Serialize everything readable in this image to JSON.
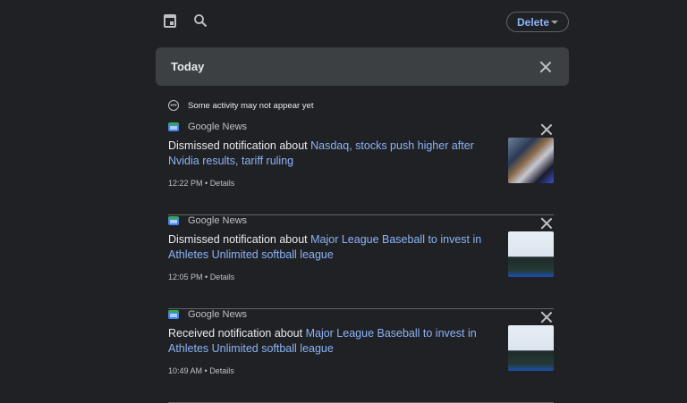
{
  "toolbar": {
    "delete_label": "Delete"
  },
  "section": {
    "title": "Today"
  },
  "notice": "Some activity may not appear yet",
  "items": [
    {
      "source": "Google News",
      "action": "Dismissed notification about ",
      "headline": "Nasdaq, stocks push higher after Nvidia results, tariff ruling",
      "time": "12:22 PM",
      "sep": " • ",
      "details": "Details"
    },
    {
      "source": "Google News",
      "action": "Dismissed notification about ",
      "headline": "Major League Baseball to invest in Athletes Unlimited softball league",
      "time": "12:05 PM",
      "sep": " • ",
      "details": "Details"
    },
    {
      "source": "Google News",
      "action": "Received notification about ",
      "headline": "Major League Baseball to invest in Athletes Unlimited softball league",
      "time": "10:49 AM",
      "sep": " • ",
      "details": "Details"
    }
  ],
  "colors": {
    "background": "#202124",
    "card": "#3c4043",
    "link": "#8ab4f8"
  }
}
